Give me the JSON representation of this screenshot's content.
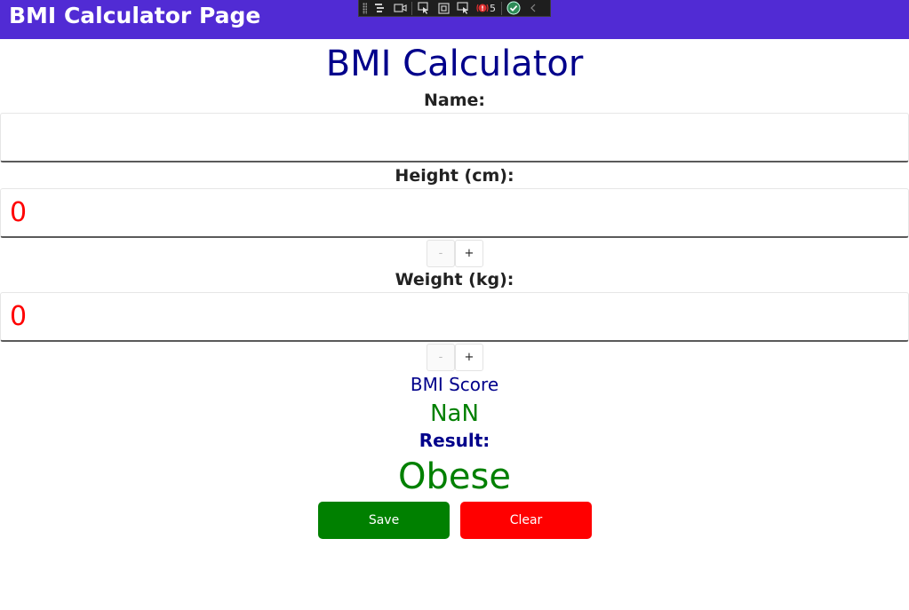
{
  "window": {
    "title": "BMI Calculator Page"
  },
  "debug_toolbar": {
    "exception_count": "5"
  },
  "page": {
    "heading": "BMI Calculator",
    "name": {
      "label": "Name:",
      "value": ""
    },
    "height": {
      "label": "Height (cm):",
      "value": "0",
      "decrement_label": "-",
      "increment_label": "+"
    },
    "weight": {
      "label": "Weight (kg):",
      "value": "0",
      "decrement_label": "-",
      "increment_label": "+"
    },
    "bmi": {
      "label": "BMI Score",
      "value": "NaN"
    },
    "result": {
      "label": "Result:",
      "value": "Obese"
    },
    "buttons": {
      "save": "Save",
      "clear": "Clear"
    }
  },
  "colors": {
    "titlebar": "#512bd4",
    "heading": "#00008b",
    "numeric_value": "#ff0000",
    "result_value": "#008000",
    "save_button": "#008000",
    "clear_button": "#ff0000"
  }
}
